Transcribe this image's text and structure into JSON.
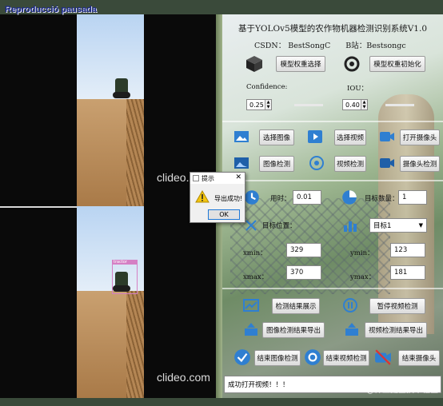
{
  "player": {
    "title": "Reproducció pausada"
  },
  "video": {
    "watermark": "clideo.com",
    "detection_label": "tractor"
  },
  "panel": {
    "title": "基于YOLOv5模型的农作物机器检测识别系统V1.0",
    "csdn": "CSDN： BestSongC",
    "bilibili": "B站：Bestsongc",
    "btn_select_weights": "模型权重选择",
    "btn_init_weights": "模型权重初始化",
    "confidence_label": "Confidence:",
    "iou_label": "IOU：",
    "confidence_value": "0.25",
    "iou_value": "0.40",
    "btn_select_image": "选择图像",
    "btn_select_video": "选择视频",
    "btn_open_camera": "打开摄像头",
    "btn_image_detect": "图像检测",
    "btn_video_detect": "视频检测",
    "btn_camera_detect": "摄像头检测",
    "time_label": "用时：",
    "time_value": "0.01",
    "count_label": "目标数量：",
    "count_value": "1",
    "position_label": "目标位置：",
    "target_select": "目标1",
    "xmin_label": "xmin：",
    "xmin_value": "329",
    "ymin_label": "ymin：",
    "ymin_value": "123",
    "xmax_label": "xmax：",
    "xmax_value": "370",
    "ymax_label": "ymax：",
    "ymax_value": "181",
    "btn_show_result": "检测结果展示",
    "btn_pause_video": "暂停视频检测",
    "btn_export_image": "图像检测结果导出",
    "btn_export_video": "视频检测结果导出",
    "btn_end_image": "结束图像检测",
    "btn_end_video": "结束视频检测",
    "btn_end_camera": "结束摄像头",
    "status_text": "成功打开视频！！！",
    "footer_watermark": "@稀土掘金技术社区"
  },
  "dialog": {
    "title": "提示",
    "message": "导出成功!",
    "ok": "OK"
  }
}
